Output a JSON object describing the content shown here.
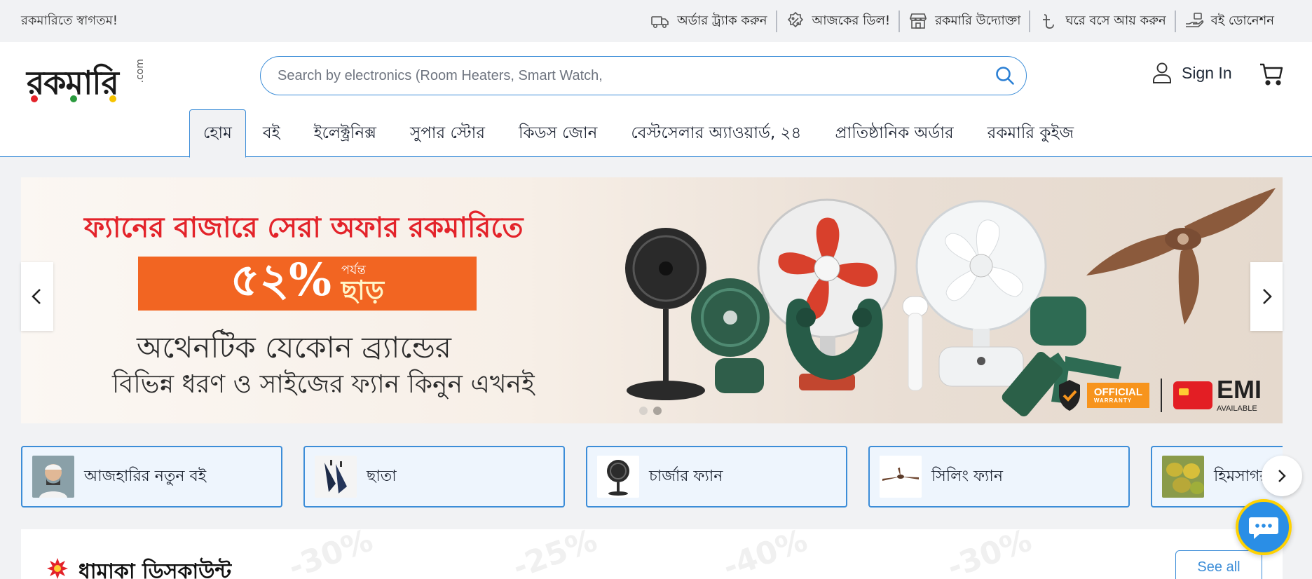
{
  "topbar": {
    "welcome": "রকমারিতে স্বাগতম!",
    "links": [
      {
        "icon": "truck-icon",
        "label": "অর্ডার ট্র্যাক করুন"
      },
      {
        "icon": "discount-badge-icon",
        "label": "আজকের ডিল!"
      },
      {
        "icon": "store-icon",
        "label": "রকমারি উদ্যোক্তা"
      },
      {
        "icon": "taka-icon",
        "label": "ঘরে বসে আয় করুন"
      },
      {
        "icon": "donate-hand-icon",
        "label": "বই ডোনেশন"
      }
    ]
  },
  "header": {
    "logo_text": "রকমারি",
    "logo_suffix": ".com",
    "search_placeholder": "Search by electronics (Room Heaters, Smart Watch,",
    "search_value": "",
    "signin_label": "Sign In"
  },
  "nav": {
    "tabs": [
      {
        "label": "হোম",
        "active": true
      },
      {
        "label": "বই"
      },
      {
        "label": "ইলেক্ট্রনিক্স"
      },
      {
        "label": "সুপার স্টোর"
      },
      {
        "label": "কিডস জোন"
      },
      {
        "label": "বেস্টসেলার অ্যাওয়ার্ড, ২৪"
      },
      {
        "label": "প্রাতিষ্ঠানিক অর্ডার"
      },
      {
        "label": "রকমারি কুইজ"
      }
    ]
  },
  "banner": {
    "headline": "ফ্যানের বাজারে সেরা অফার রকমারিতে",
    "discount": "৫২%",
    "upto_small": "পর্যন্ত",
    "upto_big": "ছাড়",
    "line1": "অথেনটিক যেকোন ব্র্যান্ডের",
    "line2": "বিভিন্ন ধরণ ও সাইজের ফ্যান কিনুন এখনই",
    "badge_official": "OFFICIAL",
    "badge_warranty": "WARRANTY",
    "badge_emi": "EMI",
    "badge_available": "AVAILABLE",
    "slides": 2,
    "active_slide": 2,
    "accent": "#e3232a",
    "orange": "#f26522"
  },
  "categories": [
    {
      "label": "আজহারির নতুন বই",
      "icon": "author-photo"
    },
    {
      "label": "ছাতা",
      "icon": "umbrella-icon"
    },
    {
      "label": "চার্জার ফ্যান",
      "icon": "table-fan-icon"
    },
    {
      "label": "সিলিং ফ্যান",
      "icon": "ceiling-fan-icon"
    },
    {
      "label": "হিমসাগর",
      "icon": "mango-icon"
    }
  ],
  "deal": {
    "title": "ধামাকা ডিসকাউন্ট",
    "see_all": "See all"
  },
  "colors": {
    "primary": "#3c8dd8",
    "background": "#f1f2f4"
  }
}
